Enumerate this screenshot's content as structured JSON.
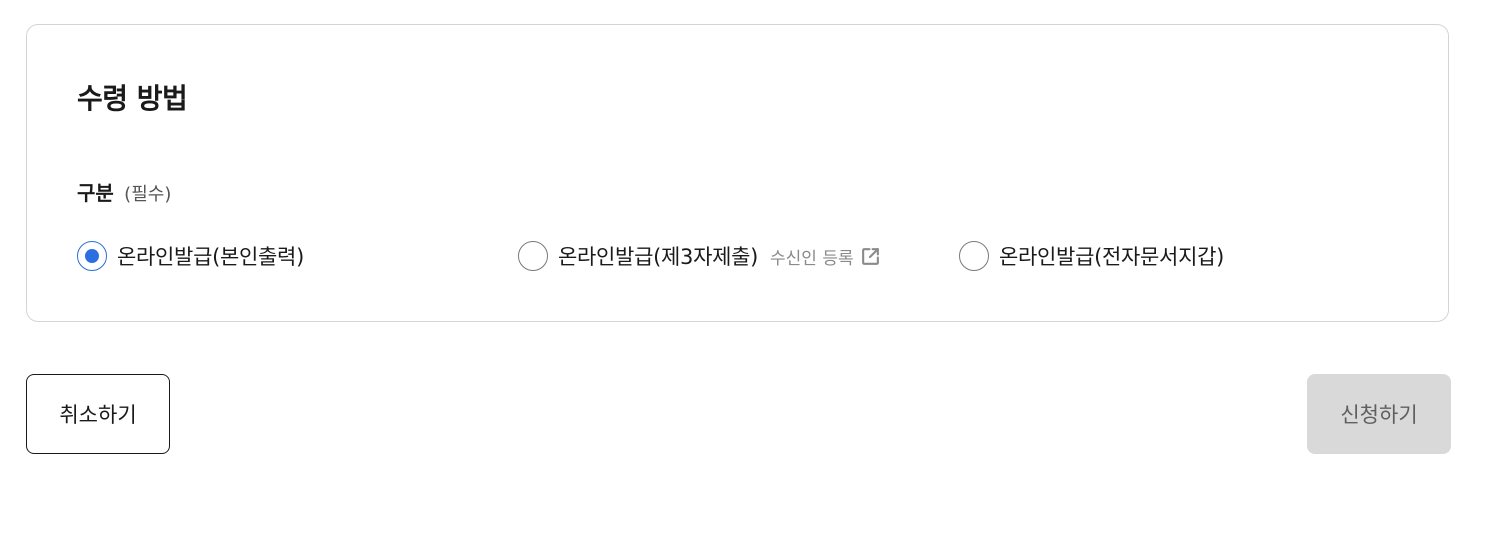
{
  "section": {
    "title": "수령 방법"
  },
  "field": {
    "label": "구분",
    "required": "(필수)"
  },
  "options": [
    {
      "label": "온라인발급(본인출력)",
      "checked": true
    },
    {
      "label": "온라인발급(제3자제출)",
      "checked": false,
      "link_label": "수신인 등록"
    },
    {
      "label": "온라인발급(전자문서지갑)",
      "checked": false
    }
  ],
  "buttons": {
    "cancel_label": "취소하기",
    "submit_label": "신청하기"
  },
  "colors": {
    "accent": "#2b6fe0",
    "disabled_bg": "#d9d9d9",
    "border": "#d4d4d4"
  }
}
